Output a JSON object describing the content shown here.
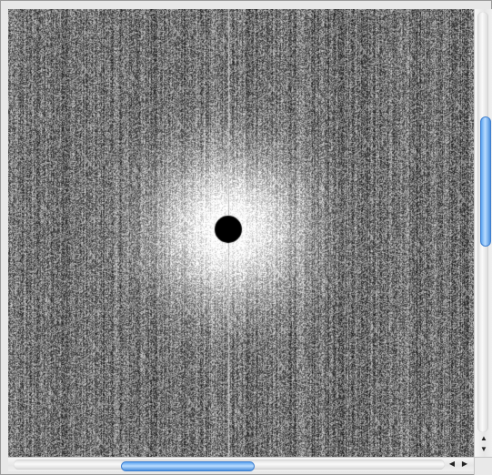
{
  "window": {
    "content": "fft-magnitude-spectrum"
  },
  "image": {
    "background_color": "#808080",
    "center_dot_color": "#000000"
  },
  "scrollbars": {
    "vertical": {
      "position_fraction": 0.36,
      "visible_fraction": 0.31,
      "up_arrow_icon": "triangle-up-icon",
      "down_arrow_icon": "triangle-down-icon"
    },
    "horizontal": {
      "position_fraction": 0.36,
      "visible_fraction": 0.31,
      "left_arrow_icon": "triangle-left-icon",
      "right_arrow_icon": "triangle-right-icon"
    },
    "accent_color": "#5aa3f0"
  }
}
